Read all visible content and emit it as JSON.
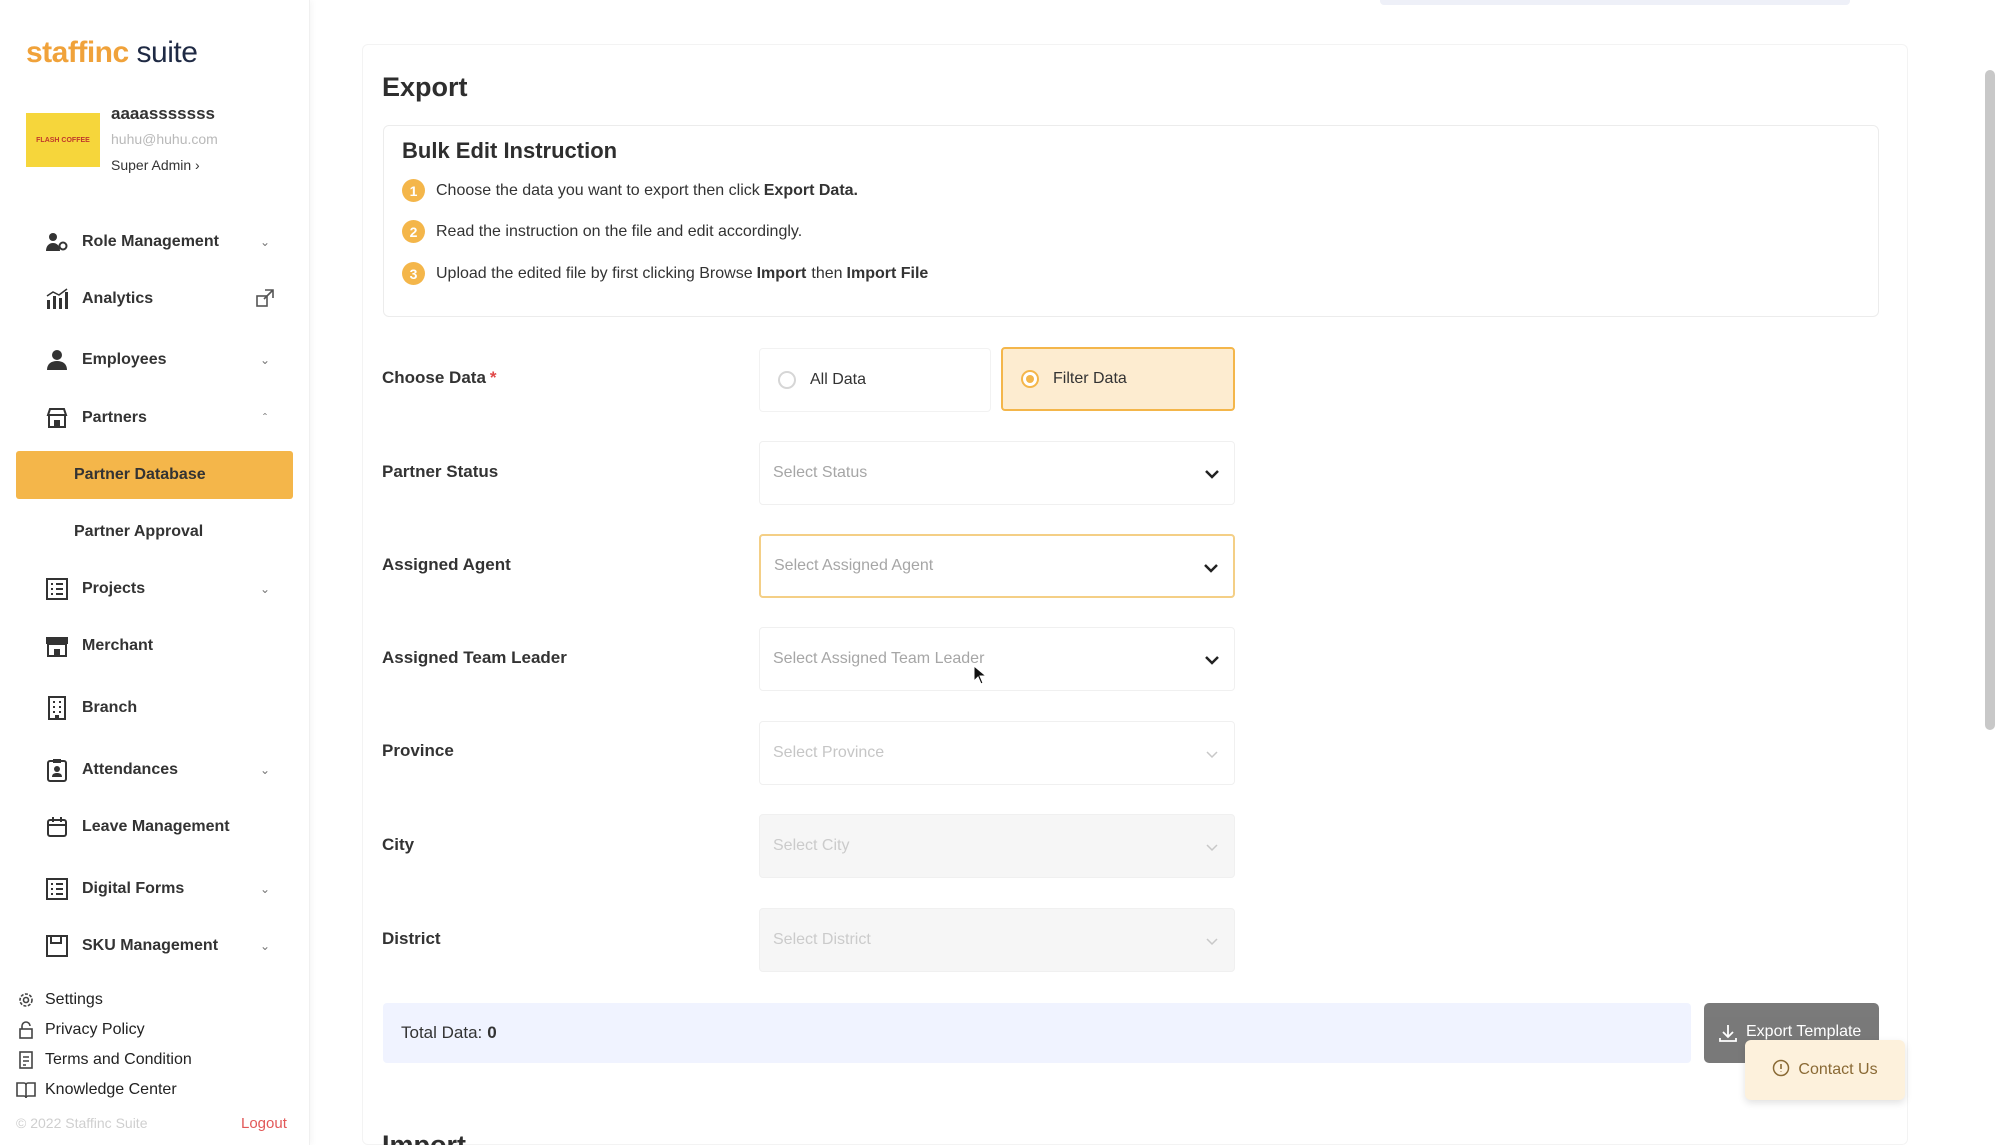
{
  "brand": {
    "logo_part1": "staff",
    "logo_part2": "inc",
    "logo_part3": " suite"
  },
  "user": {
    "name": "aaaasssssss",
    "email": "huhu@huhu.com",
    "role": "Super Admin ›",
    "avatar_text": "FLASH COFFEE"
  },
  "sidebar": {
    "items": [
      {
        "label": "Role Management",
        "icon": "users-cog-icon"
      },
      {
        "label": "Analytics",
        "icon": "bar-chart-icon"
      },
      {
        "label": "Employees",
        "icon": "people-icon"
      },
      {
        "label": "Partners",
        "icon": "store-icon"
      },
      {
        "label": "Partner Database"
      },
      {
        "label": "Partner Approval"
      },
      {
        "label": "Projects",
        "icon": "grid-list-icon"
      },
      {
        "label": "Merchant",
        "icon": "merchant-icon"
      },
      {
        "label": "Branch",
        "icon": "building-icon"
      },
      {
        "label": "Attendances",
        "icon": "clipboard-icon"
      },
      {
        "label": "Leave Management",
        "icon": "calendar-icon"
      },
      {
        "label": "Digital Forms",
        "icon": "form-icon"
      },
      {
        "label": "SKU Management",
        "icon": "sku-icon"
      }
    ],
    "bottom": [
      {
        "label": "Settings"
      },
      {
        "label": "Privacy Policy"
      },
      {
        "label": "Terms and Condition"
      },
      {
        "label": "Knowledge Center"
      }
    ],
    "copyright": "© 2022 Staffinc Suite",
    "logout": "Logout"
  },
  "main": {
    "title": "Export",
    "instruction": {
      "title": "Bulk Edit Instruction",
      "steps": [
        {
          "num": "1",
          "text": "Choose the data you want to export then click",
          "bold": "Export Data."
        },
        {
          "num": "2",
          "text": "Read the instruction on the file and edit accordingly.",
          "bold": ""
        },
        {
          "num": "3",
          "text": "Upload the edited file by first clicking Browse",
          "bold": "Import",
          "text2": "then",
          "bold2": "Import File"
        }
      ]
    },
    "fields": {
      "choose_data": {
        "label": "Choose Data",
        "required": "*",
        "options": [
          "All Data",
          "Filter Data"
        ],
        "selected": "Filter Data"
      },
      "partner_status": {
        "label": "Partner Status",
        "placeholder": "Select Status"
      },
      "assigned_agent": {
        "label": "Assigned Agent",
        "placeholder": "Select Assigned Agent"
      },
      "assigned_team_leader": {
        "label": "Assigned Team Leader",
        "placeholder": "Select Assigned Team Leader"
      },
      "province": {
        "label": "Province",
        "placeholder": "Select Province"
      },
      "city": {
        "label": "City",
        "placeholder": "Select City"
      },
      "district": {
        "label": "District",
        "placeholder": "Select District"
      }
    },
    "total": {
      "label": "Total Data:",
      "value": "0"
    },
    "export_button": "Export Template",
    "contact_button": "Contact Us",
    "import_title": "Import"
  },
  "colors": {
    "accent": "#f4b64a",
    "accent_light": "#fdecd0",
    "total_bg": "#f0f3ff"
  }
}
